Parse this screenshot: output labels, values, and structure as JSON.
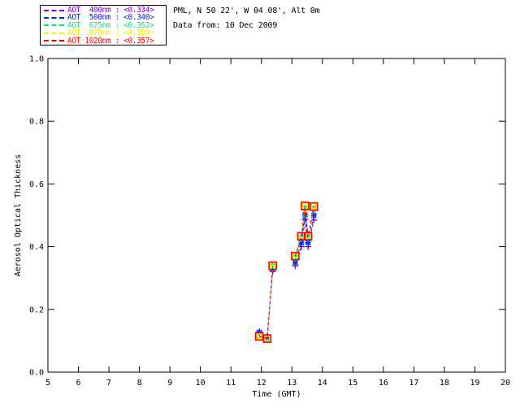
{
  "header": {
    "station_line": "PML, N 50 22', W 04 08', Alt 0m",
    "date_line": "Data from: 10 Dec 2009"
  },
  "legend": {
    "items": [
      {
        "label": "AOT  400nm : <0.334>",
        "color": "#8400D3"
      },
      {
        "label": "AOT  500nm : <0.340>",
        "color": "#0024FF"
      },
      {
        "label": "AOT  675nm : <0.352>",
        "color": "#00E07E"
      },
      {
        "label": "AOT  870nm : <0.359>",
        "color": "#F0F000"
      },
      {
        "label": "AOT 1020nm : <0.357>",
        "color": "#FF0000"
      }
    ]
  },
  "chart_data": {
    "type": "line",
    "title": "",
    "xlabel": "Time (GMT)",
    "ylabel": "Aerosol Optical Thickness",
    "xlim": [
      5,
      20
    ],
    "ylim": [
      0.0,
      1.0
    ],
    "xticks": [
      5,
      6,
      7,
      8,
      9,
      10,
      11,
      12,
      13,
      14,
      15,
      16,
      17,
      18,
      19,
      20
    ],
    "yticks": [
      0.0,
      0.2,
      0.4,
      0.6,
      0.8,
      1.0
    ],
    "grid": false,
    "legend_position": "top-left-outside",
    "line_style": "dashed",
    "line_break_after_index": 2,
    "x": [
      11.93,
      12.19,
      12.37,
      13.11,
      13.31,
      13.43,
      13.53,
      13.72
    ],
    "series": [
      {
        "name": "AOT 400nm",
        "wavelength_nm": 400,
        "mean": "<0.334>",
        "color": "#8400D3",
        "marker": "plus",
        "values": [
          0.128,
          0.113,
          0.322,
          0.339,
          0.4,
          0.487,
          0.4,
          0.485
        ]
      },
      {
        "name": "AOT 500nm",
        "wavelength_nm": 500,
        "mean": "<0.340>",
        "color": "#0024FF",
        "marker": "asterisk",
        "values": [
          0.127,
          0.112,
          0.327,
          0.35,
          0.413,
          0.502,
          0.413,
          0.5
        ]
      },
      {
        "name": "AOT 675nm",
        "wavelength_nm": 675,
        "mean": "<0.352>",
        "color": "#00E07E",
        "marker": "diamond",
        "values": [
          0.116,
          0.108,
          0.336,
          0.365,
          0.428,
          0.522,
          0.428,
          0.52
        ]
      },
      {
        "name": "AOT 870nm",
        "wavelength_nm": 870,
        "mean": "<0.359>",
        "color": "#F0F000",
        "marker": "square-small",
        "values": [
          0.114,
          0.107,
          0.341,
          0.372,
          0.435,
          0.532,
          0.435,
          0.53
        ]
      },
      {
        "name": "AOT 1020nm",
        "wavelength_nm": 1020,
        "mean": "<0.357>",
        "color": "#FF0000",
        "marker": "square",
        "values": [
          0.114,
          0.107,
          0.339,
          0.37,
          0.433,
          0.53,
          0.433,
          0.528
        ]
      }
    ]
  }
}
